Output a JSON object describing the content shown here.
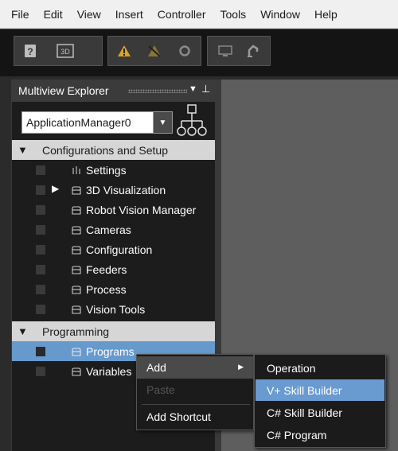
{
  "menubar": {
    "items": [
      "File",
      "Edit",
      "View",
      "Insert",
      "Controller",
      "Tools",
      "Window",
      "Help"
    ]
  },
  "toolbar": {
    "buttons": [
      {
        "icon": "help-icon"
      },
      {
        "icon": "3d-view-icon",
        "label": "3D"
      },
      {
        "icon": "warning-icon"
      },
      {
        "icon": "clear-warning-icon"
      },
      {
        "icon": "refresh-icon"
      },
      {
        "icon": "monitor-icon"
      },
      {
        "icon": "robot-arm-icon"
      }
    ],
    "warning_color": "#d9a520"
  },
  "explorer": {
    "title": "Multiview Explorer",
    "dropdown_value": "ApplicationManager0",
    "sections": [
      {
        "label": "Configurations and Setup",
        "items": [
          {
            "label": "Settings",
            "icon": "settings-icon"
          },
          {
            "label": "3D Visualization",
            "icon": "folder-icon",
            "expandable": true
          },
          {
            "label": "Robot Vision Manager",
            "icon": "folder-icon"
          },
          {
            "label": "Cameras",
            "icon": "folder-icon"
          },
          {
            "label": "Configuration",
            "icon": "folder-icon"
          },
          {
            "label": "Feeders",
            "icon": "folder-icon"
          },
          {
            "label": "Process",
            "icon": "folder-icon"
          },
          {
            "label": "Vision Tools",
            "icon": "folder-icon"
          }
        ]
      },
      {
        "label": "Programming",
        "items": [
          {
            "label": "Programs",
            "icon": "folder-icon",
            "selected": true
          },
          {
            "label": "Variables",
            "icon": "folder-icon"
          }
        ]
      }
    ],
    "selection_color": "#6699cc"
  },
  "context_menu": {
    "items": [
      {
        "label": "Add",
        "has_submenu": true
      },
      {
        "label": "Paste",
        "disabled": true
      },
      {
        "label": "Add Shortcut"
      }
    ]
  },
  "submenu": {
    "items": [
      {
        "label": "Operation"
      },
      {
        "label": "V+ Skill Builder",
        "highlighted": true
      },
      {
        "label": "C# Skill Builder"
      },
      {
        "label": "C# Program"
      }
    ],
    "highlight_color": "#6a9bd0"
  }
}
